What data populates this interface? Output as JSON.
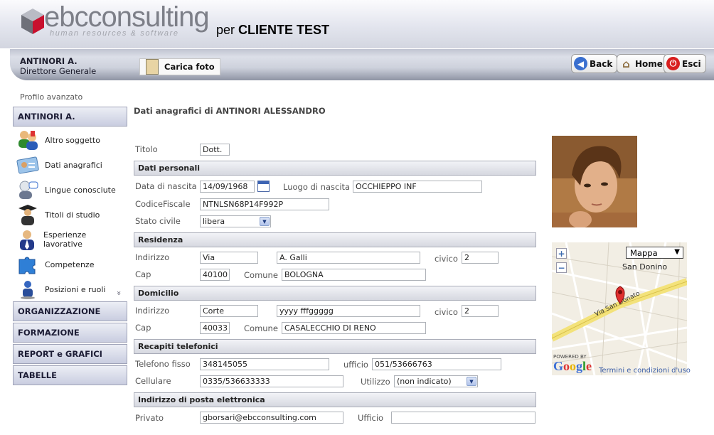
{
  "header": {
    "logo_main": "ebcconsulting",
    "logo_tagline": "human resources & software",
    "client_prefix": "per",
    "client_name": "CLIENTE TEST"
  },
  "user": {
    "name": "ANTINORI A.",
    "role": "Direttore Generale"
  },
  "toolbar": {
    "upload_photo": "Carica foto",
    "back": "Back",
    "home": "Home",
    "exit": "Esci"
  },
  "sidebar": {
    "caption": "Profilo avanzato",
    "current": "ANTINORI A.",
    "items": [
      {
        "label": "Altro soggetto",
        "icon": "users-icon"
      },
      {
        "label": "Dati anagrafici",
        "icon": "id-card-icon"
      },
      {
        "label": "Lingue conosciute",
        "icon": "speech-icon"
      },
      {
        "label": "Titoli di studio",
        "icon": "graduate-icon"
      },
      {
        "label": "Esperienze lavorative",
        "icon": "worker-icon"
      },
      {
        "label": "Competenze",
        "icon": "puzzle-icon"
      },
      {
        "label": "Posizioni e ruoli",
        "icon": "person-icon"
      }
    ],
    "scroll_indicator": "»",
    "groups": [
      "ORGANIZZAZIONE",
      "FORMAZIONE",
      "REPORT e GRAFICI",
      "TABELLE"
    ]
  },
  "form": {
    "title": "Dati anagrafici di ANTINORI ALESSANDRO",
    "titolo_label": "Titolo",
    "titolo": "Dott.",
    "personal": {
      "section": "Dati personali",
      "birthdate_label": "Data di nascita",
      "birthdate": "14/09/1968",
      "birthplace_label": "Luogo di nascita",
      "birthplace": "OCCHIEPPO INF",
      "fiscal_label": "CodiceFiscale",
      "fiscal_code": "NTNLSN68P14F992P",
      "marital_label": "Stato civile",
      "marital_status": "libera"
    },
    "residenza": {
      "section": "Residenza",
      "address_label": "Indirizzo",
      "street_type": "Via",
      "street": "A. Galli",
      "civic_label": "civico",
      "civic": "2",
      "cap_label": "Cap",
      "cap": "40100",
      "comune_label": "Comune",
      "comune": "BOLOGNA"
    },
    "domicilio": {
      "section": "Domicilio",
      "address_label": "Indirizzo",
      "street_type": "Corte",
      "street": "yyyy fffggggg",
      "civic_label": "civico",
      "civic": "2",
      "cap_label": "Cap",
      "cap": "40033",
      "comune_label": "Comune",
      "comune": "CASALECCHIO DI RENO"
    },
    "phones": {
      "section": "Recapiti telefonici",
      "landline_label": "Telefono fisso",
      "landline": "348145055",
      "office_label": "ufficio",
      "office": "051/53666763",
      "mobile_label": "Cellulare",
      "mobile": "0335/536633333",
      "usage_label": "Utilizzo",
      "usage": "(non indicato)"
    },
    "email": {
      "section": "Indirizzo di posta elettronica",
      "private_label": "Privato",
      "private": "gborsari@ebcconsulting.com",
      "office_label": "Ufficio",
      "office": ""
    }
  },
  "map": {
    "type": "Mappa",
    "zoom_in": "+",
    "zoom_out": "−",
    "place": "San Donino",
    "street": "Via San Donato",
    "powered_by": "POWERED BY",
    "google": "Google",
    "terms": "Termini e condizioni d'uso"
  },
  "colors": {
    "back": "#3a6fcf",
    "home": "#8a6a3a",
    "exit": "#d81e1e",
    "road": "#f3e27a"
  }
}
